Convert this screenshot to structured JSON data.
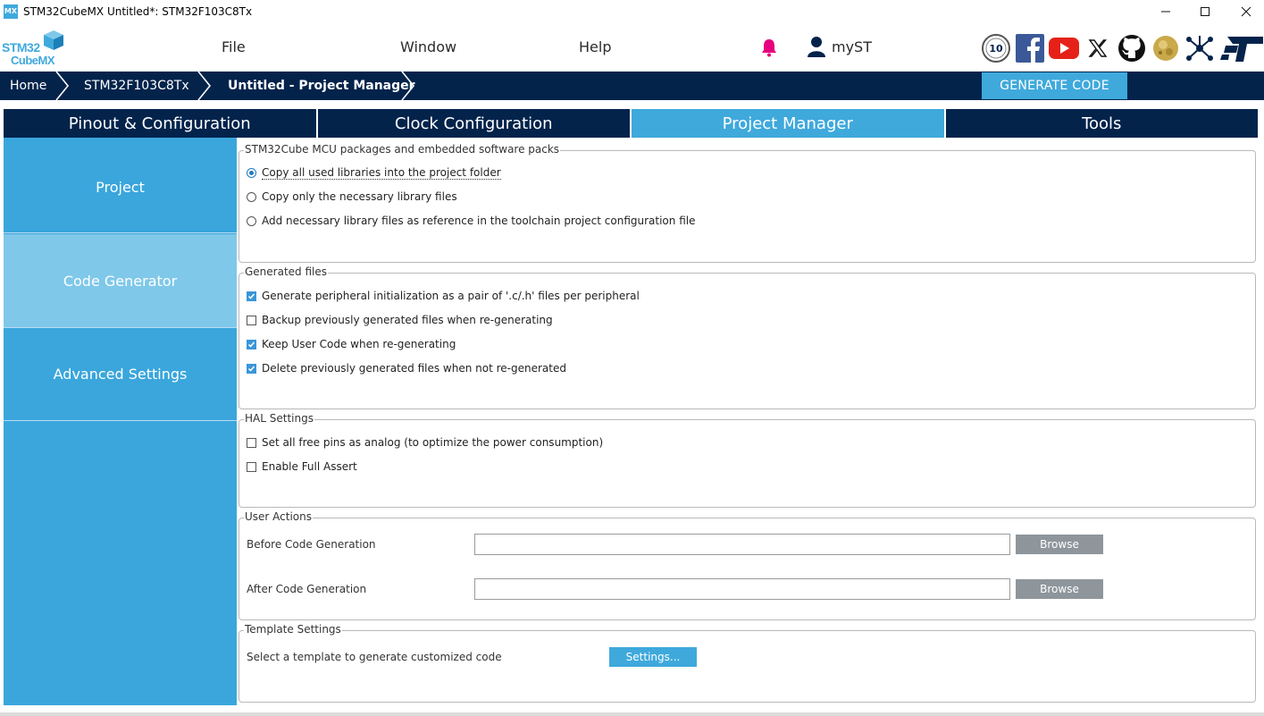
{
  "window": {
    "title": "STM32CubeMX Untitled*: STM32F103C8Tx",
    "icon_text": "MX",
    "controls": [
      "minimize-icon",
      "maximize-icon",
      "close-icon"
    ]
  },
  "logo": {
    "line1": "STM32",
    "line2": "CubeMX"
  },
  "menu": {
    "file": "File",
    "window": "Window",
    "help": "Help",
    "user": "myST"
  },
  "social_icons": [
    "10-years-badge-icon",
    "facebook-icon",
    "youtube-icon",
    "x-twitter-icon",
    "github-icon",
    "wiki-globe-icon",
    "network-share-icon",
    "st-logo-icon"
  ],
  "breadcrumb": {
    "home": "Home",
    "device": "STM32F103C8Tx",
    "current": "Untitled - Project Manager"
  },
  "generate_button": "GENERATE CODE",
  "tabs": [
    {
      "label": "Pinout & Configuration",
      "active": false
    },
    {
      "label": "Clock Configuration",
      "active": false
    },
    {
      "label": "Project Manager",
      "active": true
    },
    {
      "label": "Tools",
      "active": false
    }
  ],
  "sidenav": [
    {
      "label": "Project",
      "active": false
    },
    {
      "label": "Code Generator",
      "active": true
    },
    {
      "label": "Advanced Settings",
      "active": false
    }
  ],
  "packages": {
    "title": "STM32Cube MCU packages and embedded software packs",
    "options": [
      {
        "label": "Copy all used libraries into the project folder",
        "selected": true
      },
      {
        "label": "Copy only the necessary library files",
        "selected": false
      },
      {
        "label": "Add necessary library files as reference in the toolchain project configuration file",
        "selected": false
      }
    ]
  },
  "generated_files": {
    "title": "Generated files",
    "options": [
      {
        "label": "Generate peripheral initialization as a pair of '.c/.h' files per peripheral",
        "checked": true
      },
      {
        "label": "Backup previously generated files when re-generating",
        "checked": false
      },
      {
        "label": "Keep User Code when re-generating",
        "checked": true
      },
      {
        "label": "Delete previously generated files when not re-generated",
        "checked": true
      }
    ]
  },
  "hal_settings": {
    "title": "HAL Settings",
    "options": [
      {
        "label": "Set all free pins as analog (to optimize the power consumption)",
        "checked": false
      },
      {
        "label": "Enable Full Assert",
        "checked": false
      }
    ]
  },
  "user_actions": {
    "title": "User Actions",
    "before_label": "Before Code Generation",
    "before_value": "",
    "after_label": "After Code Generation",
    "after_value": "",
    "browse_label": "Browse"
  },
  "template_settings": {
    "title": "Template Settings",
    "label": "Select a template to generate customized code",
    "button": "Settings..."
  },
  "colors": {
    "navy": "#03234b",
    "accent": "#3fa9dc",
    "nav_active": "#7fc8ea",
    "bell": "#e6007e"
  }
}
